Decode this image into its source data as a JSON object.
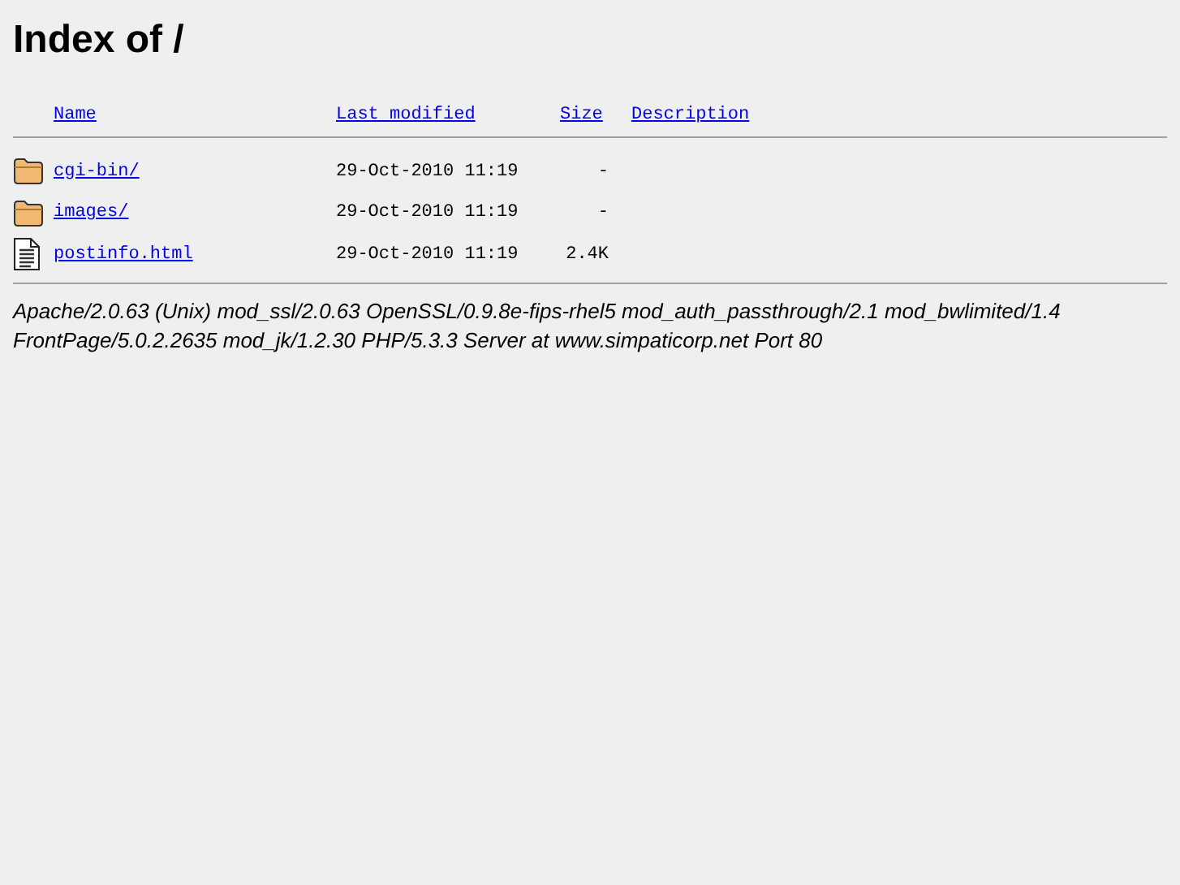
{
  "title": "Index of /",
  "columns": [
    "Name",
    "Last modified",
    "Size",
    "Description"
  ],
  "rows": [
    {
      "kind": "folder",
      "name": "cgi-bin/",
      "modified": "29-Oct-2010 11:19",
      "size": "-"
    },
    {
      "kind": "folder",
      "name": "images/",
      "modified": "29-Oct-2010 11:19",
      "size": "-"
    },
    {
      "kind": "file",
      "name": "postinfo.html",
      "modified": "29-Oct-2010 11:19",
      "size": "2.4K"
    }
  ],
  "address": [
    "Apache/2.0.63 (Unix) mod_ssl/2.0.63 OpenSSL/0.9.8e-fips-rhel5 mod_auth_passthrough/2.1 mod_bwlimited/1.4",
    "FrontPage/5.0.2.2635 mod_jk/1.2.30 PHP/5.3.3 Server at www.simpaticorp.net Port 80"
  ]
}
